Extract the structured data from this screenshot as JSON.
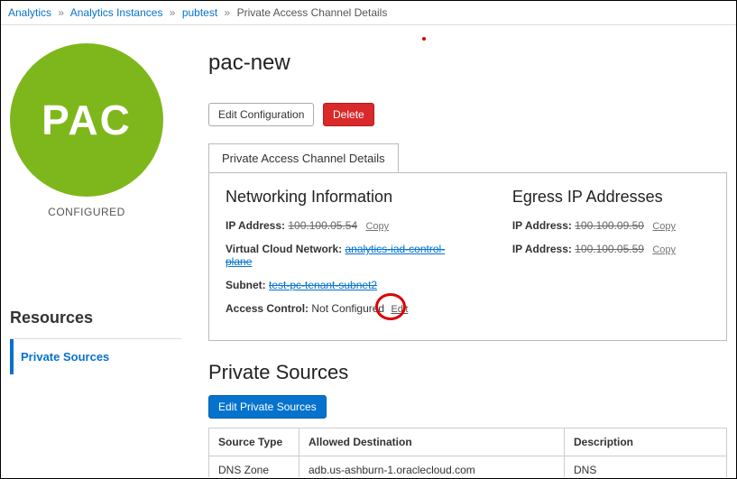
{
  "breadcrumbs": {
    "items": [
      {
        "label": "Analytics"
      },
      {
        "label": "Analytics Instances"
      },
      {
        "label": "pubtest"
      }
    ],
    "current": "Private Access Channel Details"
  },
  "pac_badge": {
    "text": "PAC",
    "status": "CONFIGURED"
  },
  "resources": {
    "heading": "Resources",
    "items": [
      {
        "label": "Private Sources"
      }
    ]
  },
  "page": {
    "title": "pac-new",
    "edit_button": "Edit Configuration",
    "delete_button": "Delete"
  },
  "tab": {
    "label": "Private Access Channel Details"
  },
  "networking": {
    "heading": "Networking Information",
    "ip_label": "IP Address:",
    "ip_value": "100.100.05.54",
    "ip_copy": "Copy",
    "vcn_label": "Virtual Cloud Network:",
    "vcn_value": "analytics-iad-control-plane",
    "subnet_label": "Subnet:",
    "subnet_value": "test-pc-tenant-subnet2",
    "ac_label": "Access Control:",
    "ac_value": "Not Configured",
    "ac_edit": "Edit"
  },
  "egress": {
    "heading": "Egress IP Addresses",
    "rows": [
      {
        "label": "IP Address:",
        "value": "100.100.09.50",
        "copy": "Copy"
      },
      {
        "label": "IP Address:",
        "value": "100.100.05.59",
        "copy": "Copy"
      }
    ]
  },
  "private_sources": {
    "heading": "Private Sources",
    "edit_button": "Edit Private Sources",
    "columns": {
      "source_type": "Source Type",
      "allowed_dest": "Allowed Destination",
      "description": "Description"
    },
    "rows": [
      {
        "source_type": "DNS Zone",
        "allowed_dest": "adb.us-ashburn-1.oraclecloud.com",
        "description": "DNS"
      }
    ]
  }
}
